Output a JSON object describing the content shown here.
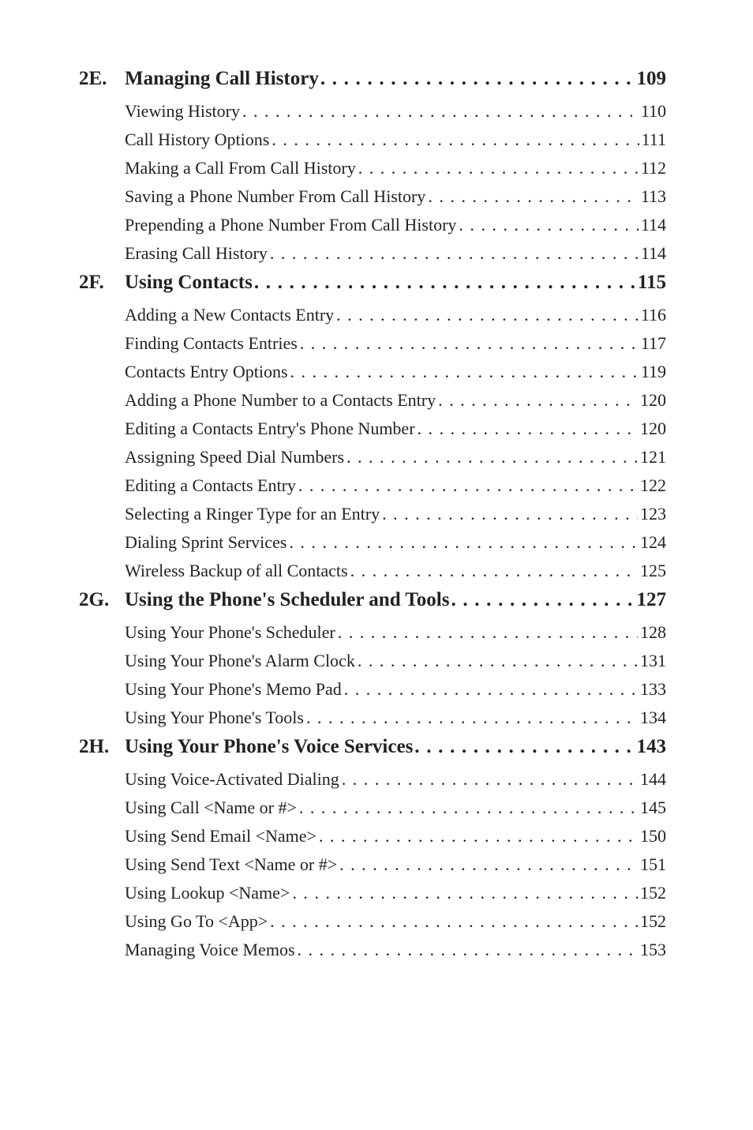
{
  "sections": [
    {
      "prefix": "2E.",
      "title": "Managing Call History",
      "page": "109",
      "entries": [
        {
          "text": "Viewing History",
          "page": "110"
        },
        {
          "text": "Call History Options",
          "page": "111"
        },
        {
          "text": "Making a Call From Call History",
          "page": "112"
        },
        {
          "text": "Saving a Phone Number From Call History",
          "page": "113"
        },
        {
          "text": "Prepending a Phone Number From Call History",
          "page": "114"
        },
        {
          "text": "Erasing Call History",
          "page": "114"
        }
      ]
    },
    {
      "prefix": "2F.",
      "title": "Using Contacts",
      "page": "115",
      "entries": [
        {
          "text": "Adding a New Contacts Entry",
          "page": "116"
        },
        {
          "text": "Finding Contacts Entries",
          "page": "117"
        },
        {
          "text": "Contacts Entry Options",
          "page": "119"
        },
        {
          "text": "Adding a Phone Number to a Contacts Entry",
          "page": "120"
        },
        {
          "text": "Editing a Contacts Entry's Phone Number",
          "page": "120"
        },
        {
          "text": "Assigning Speed Dial Numbers",
          "page": "121"
        },
        {
          "text": "Editing a Contacts Entry",
          "page": "122"
        },
        {
          "text": "Selecting a Ringer Type for an Entry",
          "page": "123"
        },
        {
          "text": "Dialing Sprint Services",
          "page": "124"
        },
        {
          "text": "Wireless Backup of all Contacts",
          "page": "125"
        }
      ]
    },
    {
      "prefix": "2G.",
      "title": "Using the Phone's Scheduler and Tools",
      "page": "127",
      "entries": [
        {
          "text": "Using Your Phone's Scheduler",
          "page": "128"
        },
        {
          "text": "Using Your Phone's Alarm Clock",
          "page": "131"
        },
        {
          "text": "Using Your Phone's Memo Pad",
          "page": "133"
        },
        {
          "text": "Using Your Phone's Tools",
          "page": "134"
        }
      ]
    },
    {
      "prefix": "2H.",
      "title": "Using Your Phone's Voice Services",
      "page": "143",
      "entries": [
        {
          "text": "Using Voice-Activated Dialing",
          "page": "144"
        },
        {
          "text": "Using Call <Name or #>",
          "page": "145"
        },
        {
          "text": "Using Send Email <Name>",
          "page": "150"
        },
        {
          "text": "Using Send Text <Name or #>",
          "page": "151"
        },
        {
          "text": "Using Lookup <Name>",
          "page": "152"
        },
        {
          "text": "Using Go To <App>",
          "page": "152"
        },
        {
          "text": "Managing Voice Memos",
          "page": "153"
        }
      ]
    }
  ]
}
